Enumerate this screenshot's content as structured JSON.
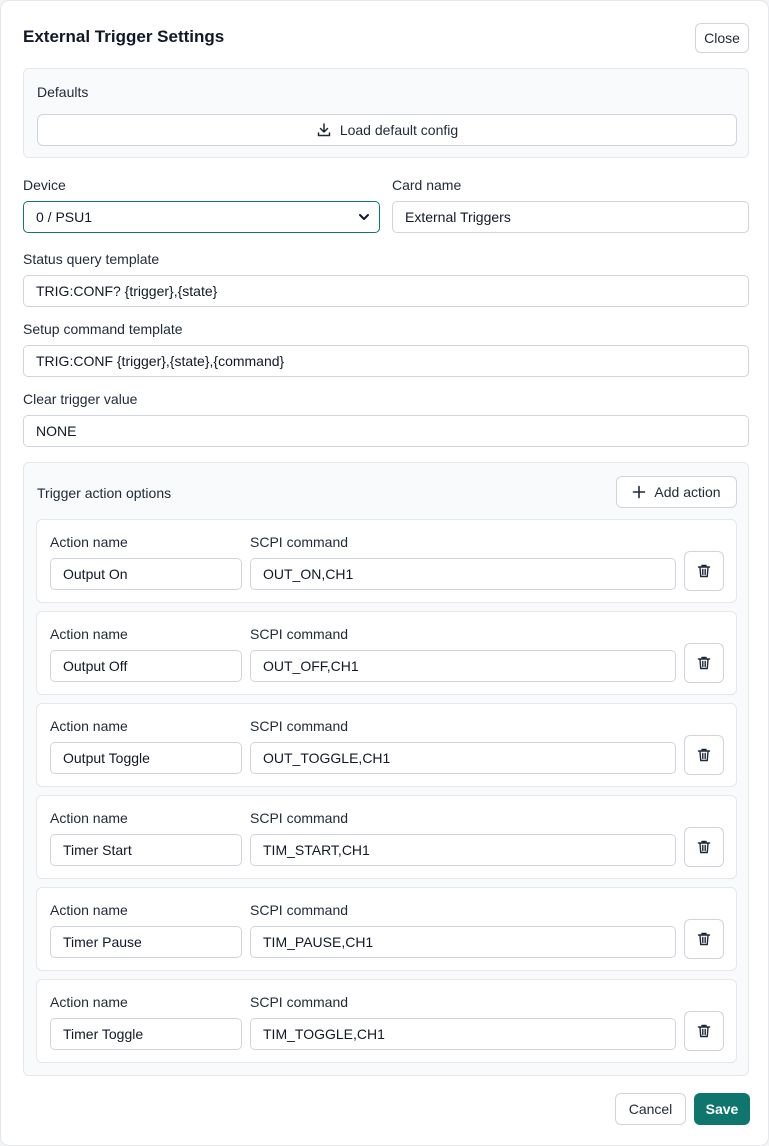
{
  "title": "External Trigger Settings",
  "close_label": "Close",
  "defaults": {
    "heading": "Defaults",
    "load_label": "Load default config"
  },
  "device": {
    "label": "Device",
    "value": "0 / PSU1"
  },
  "card_name": {
    "label": "Card name",
    "value": "External Triggers"
  },
  "status_query": {
    "label": "Status query template",
    "value": "TRIG:CONF? {trigger},{state}"
  },
  "setup_command": {
    "label": "Setup command template",
    "value": "TRIG:CONF {trigger},{state},{command}"
  },
  "clear_value": {
    "label": "Clear trigger value",
    "value": "NONE"
  },
  "actions_panel": {
    "heading": "Trigger action options",
    "add_label": "Add action",
    "name_label": "Action name",
    "cmd_label": "SCPI command",
    "items": [
      {
        "name": "Output On",
        "command": "OUT_ON,CH1"
      },
      {
        "name": "Output Off",
        "command": "OUT_OFF,CH1"
      },
      {
        "name": "Output Toggle",
        "command": "OUT_TOGGLE,CH1"
      },
      {
        "name": "Timer Start",
        "command": "TIM_START,CH1"
      },
      {
        "name": "Timer Pause",
        "command": "TIM_PAUSE,CH1"
      },
      {
        "name": "Timer Toggle",
        "command": "TIM_TOGGLE,CH1"
      }
    ]
  },
  "footer": {
    "cancel_label": "Cancel",
    "save_label": "Save"
  },
  "icons": {
    "download": "download-icon",
    "plus": "plus-icon",
    "trash": "trash-icon",
    "chevron": "chevron-down-icon"
  },
  "colors": {
    "primary": "#0f766e",
    "panel_bg": "#f9fafb",
    "border": "#d1d5db"
  }
}
